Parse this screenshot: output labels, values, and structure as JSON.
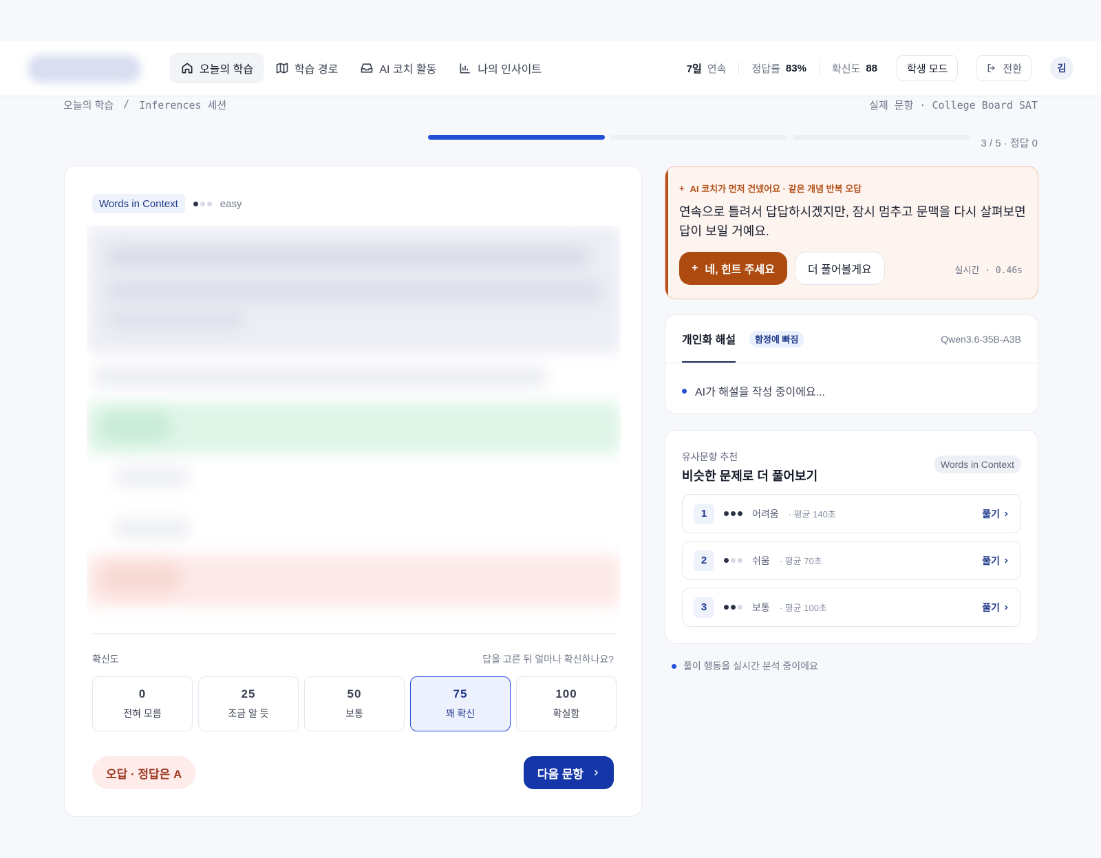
{
  "nav": {
    "items": [
      {
        "label": "오늘의 학습",
        "icon": "home-icon",
        "active": true
      },
      {
        "label": "학습 경로",
        "icon": "map-icon",
        "active": false
      },
      {
        "label": "AI 코치 활동",
        "icon": "inbox-icon",
        "active": false
      },
      {
        "label": "나의 인사이트",
        "icon": "bar-chart-icon",
        "active": false
      }
    ]
  },
  "stats": {
    "streak_value": "7일",
    "streak_label": "연속",
    "accuracy_label": "정답률",
    "accuracy_value": "83%",
    "confidence_label": "확신도",
    "confidence_value": "88",
    "mode_button": "학생 모드",
    "switch_button": "전환",
    "avatar": "김"
  },
  "breadcrumb": {
    "root": "오늘의 학습",
    "separator": "/",
    "current": "Inferences 세션"
  },
  "source_label": "실제 문항 · College Board SAT",
  "progress": {
    "text": "3 / 5 · 정답 0",
    "segments_done": 1,
    "segments_total": 3
  },
  "question": {
    "tag": "Words in Context",
    "difficulty": "easy",
    "difficulty_level": 1,
    "confidence_label": "확신도",
    "confidence_question": "답을 고른 뒤 얼마나 확신하나요?",
    "confidence_options": [
      {
        "value": "0",
        "label": "전혀 모름",
        "selected": false
      },
      {
        "value": "25",
        "label": "조금 알 듯",
        "selected": false
      },
      {
        "value": "50",
        "label": "보통",
        "selected": false
      },
      {
        "value": "75",
        "label": "꽤 확신",
        "selected": true
      },
      {
        "value": "100",
        "label": "확실함",
        "selected": false
      }
    ],
    "result_badge": "오답 · 정답은 A",
    "next_button": "다음 문항"
  },
  "coach": {
    "header": "AI 코치가 먼저 건넸어요 · 같은 개념 반복 오답",
    "message": "연속으로 틀려서 답답하시겠지만, 잠시 멈추고 문맥을 다시 살펴보면 답이 보일 거예요.",
    "primary_button": "네, 힌트 주세요",
    "secondary_button": "더 풀어볼게요",
    "latency": "실시간 · 0.46s"
  },
  "explanation": {
    "tab": "개인화 해설",
    "badge": "함정에 빠짐",
    "model": "Qwen3.6-35B-A3B",
    "status": "AI가 해설을 작성 중이에요..."
  },
  "similar": {
    "subtitle": "유사문항 추천",
    "title": "비슷한 문제로 더 풀어보기",
    "tag": "Words in Context",
    "items": [
      {
        "num": "1",
        "level": "어려움",
        "level_dots": 3,
        "avg": "· 평균 140초",
        "action": "풀기"
      },
      {
        "num": "2",
        "level": "쉬움",
        "level_dots": 1,
        "avg": "· 평균 70초",
        "action": "풀기"
      },
      {
        "num": "3",
        "level": "보통",
        "level_dots": 2,
        "avg": "· 평균 100초",
        "action": "풀기"
      }
    ]
  },
  "analysis_status": "풀이 행동을 실시간 분석 중이에요",
  "colors": {
    "accent": "#2450d6",
    "primary_dark": "#1436a8",
    "coach_orange": "#ad4b10",
    "error_bg": "#fdecea"
  }
}
